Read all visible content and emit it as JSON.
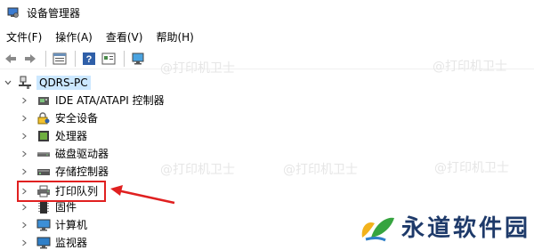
{
  "window": {
    "title": "设备管理器",
    "icon": "device-manager-icon"
  },
  "menu": [
    "文件(F)",
    "操作(A)",
    "查看(V)",
    "帮助(H)"
  ],
  "toolbar": {
    "buttons": [
      "back-arrow-icon",
      "forward-arrow-icon",
      "properties-icon",
      "help-icon",
      "view-icon",
      "monitor-scan-icon"
    ]
  },
  "tree": {
    "root": {
      "label": "QDRS-PC",
      "icon": "computer-network-icon",
      "expanded": true
    },
    "items": [
      {
        "label": "IDE ATA/ATAPI 控制器",
        "icon": "ide-controller-icon"
      },
      {
        "label": "安全设备",
        "icon": "security-device-icon"
      },
      {
        "label": "处理器",
        "icon": "processor-icon"
      },
      {
        "label": "磁盘驱动器",
        "icon": "disk-drive-icon"
      },
      {
        "label": "存储控制器",
        "icon": "storage-controller-icon"
      },
      {
        "label": "打印队列",
        "icon": "printer-icon",
        "highlighted": true
      },
      {
        "label": "固件",
        "icon": "firmware-chip-icon"
      },
      {
        "label": "计算机",
        "icon": "computer-icon"
      },
      {
        "label": "监视器",
        "icon": "monitor-icon"
      }
    ]
  },
  "watermarks": [
    "@打印机卫士",
    "@打印机卫士",
    "@打印机卫士",
    "@打印机卫士",
    "@打印机卫士"
  ],
  "brand": {
    "name": "永道软件园",
    "icon": "leaf-logo-icon"
  },
  "colors": {
    "highlight": "#e02020",
    "brand_text": "#1e3a6a",
    "root_selected_bg": "#cce8ff"
  }
}
